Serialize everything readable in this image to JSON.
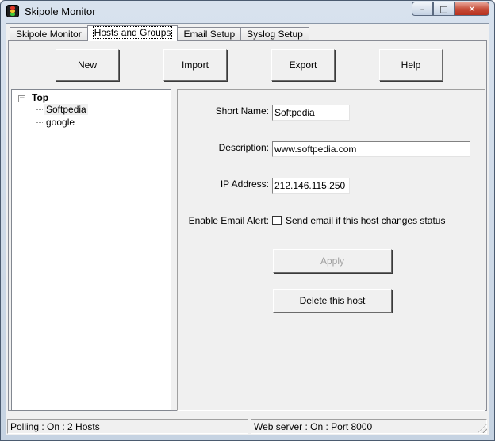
{
  "window": {
    "title": "Skipole Monitor",
    "buttons": {
      "minimize": "–",
      "maximize": "□",
      "close": "✕"
    },
    "icon": "traffic-light-icon"
  },
  "tabs": [
    {
      "label": "Skipole Monitor",
      "active": false
    },
    {
      "label": "Hosts and Groups",
      "active": true
    },
    {
      "label": "Email Setup",
      "active": false
    },
    {
      "label": "Syslog Setup",
      "active": false
    }
  ],
  "toolbar": {
    "new_label": "New",
    "import_label": "Import",
    "export_label": "Export",
    "help_label": "Help"
  },
  "tree": {
    "expander": "−",
    "root": "Top",
    "children": [
      "Softpedia",
      "google"
    ],
    "selected": "Softpedia"
  },
  "form": {
    "short_name_label": "Short Name:",
    "short_name_value": "Softpedia",
    "description_label": "Description:",
    "description_value": "www.softpedia.com",
    "ip_label": "IP Address:",
    "ip_value": "212.146.115.250",
    "email_alert_label": "Enable Email Alert:",
    "email_alert_checkbox_label": "Send email if this host changes status",
    "email_alert_checked": false,
    "apply_label": "Apply",
    "delete_label": "Delete this host"
  },
  "status": {
    "polling": "Polling : On : 2 Hosts",
    "web_server": "Web server : On : Port 8000"
  }
}
